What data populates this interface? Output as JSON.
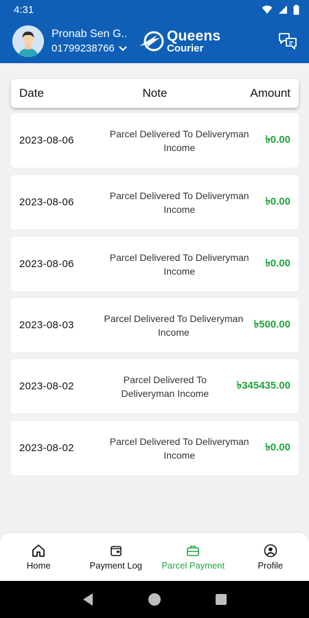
{
  "status_bar": {
    "time": "4:31"
  },
  "header": {
    "user_name": "Pronab Sen G..",
    "user_phone": "01799238766",
    "logo_title": "Queens",
    "logo_subtitle": "Courier"
  },
  "table": {
    "columns": {
      "date": "Date",
      "note": "Note",
      "amount": "Amount"
    },
    "rows": [
      {
        "date": "2023-08-06",
        "note": "Parcel Delivered To Deliveryman Income",
        "amount": "৳0.00"
      },
      {
        "date": "2023-08-06",
        "note": "Parcel Delivered To Deliveryman Income",
        "amount": "৳0.00"
      },
      {
        "date": "2023-08-06",
        "note": "Parcel Delivered To Deliveryman Income",
        "amount": "৳0.00"
      },
      {
        "date": "2023-08-03",
        "note": "Parcel Delivered To Deliveryman Income",
        "amount": "৳500.00"
      },
      {
        "date": "2023-08-02",
        "note": "Parcel Delivered To Deliveryman Income",
        "amount": "৳345435.00"
      },
      {
        "date": "2023-08-02",
        "note": "Parcel Delivered To Deliveryman Income",
        "amount": "৳0.00"
      }
    ]
  },
  "bottom_nav": {
    "items": [
      {
        "label": "Home",
        "icon": "home-icon",
        "active": false
      },
      {
        "label": "Payment Log",
        "icon": "wallet-icon",
        "active": false
      },
      {
        "label": "Parcel Payment",
        "icon": "briefcase-icon",
        "active": true
      },
      {
        "label": "Profile",
        "icon": "profile-icon",
        "active": false
      }
    ]
  },
  "colors": {
    "primary": "#0f5fb6",
    "accent_green": "#1fa33a",
    "background": "#f0f1f3"
  }
}
